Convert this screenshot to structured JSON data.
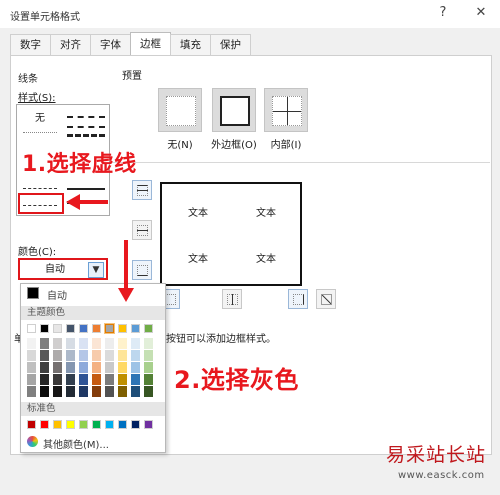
{
  "window": {
    "title": "设置单元格格式",
    "help_icon": "?",
    "close_icon": "✕"
  },
  "tabs": [
    {
      "label": "数字",
      "active": false
    },
    {
      "label": "对齐",
      "active": false
    },
    {
      "label": "字体",
      "active": false
    },
    {
      "label": "边框",
      "active": true
    },
    {
      "label": "填充",
      "active": false
    },
    {
      "label": "保护",
      "active": false
    }
  ],
  "line": {
    "group_label": "线条",
    "style_label": "样式(S):",
    "none_label": "无",
    "color_label": "颜色(C):",
    "color_value": "自动"
  },
  "presets": {
    "group_label": "预置",
    "items": [
      {
        "label": "无(N)"
      },
      {
        "label": "外边框(O)"
      },
      {
        "label": "内部(I)"
      }
    ]
  },
  "border": {
    "preview_cell_text": [
      "文本",
      "文本",
      "文本",
      "文本"
    ],
    "hint_fragment": "按钮可以添加边框样式。",
    "hint_prefix": "单"
  },
  "palette": {
    "auto_label": "自动",
    "theme_label": "主题颜色",
    "standard_label": "标准色",
    "more_label": "其他颜色(M)...",
    "theme_top_row": [
      "#ffffff",
      "#000000",
      "#e7e6e6",
      "#44546a",
      "#4472c4",
      "#ed7d31",
      "#a5a5a5",
      "#ffc000",
      "#5b9bd5",
      "#70ad47"
    ],
    "theme_shades": [
      [
        "#f2f2f2",
        "#7f7f7f",
        "#d0cece",
        "#d6dce4",
        "#d9e2f3",
        "#fbe5d5",
        "#ededed",
        "#fff2cc",
        "#deebf6",
        "#e2efd9"
      ],
      [
        "#d8d8d8",
        "#595959",
        "#aeabab",
        "#adb9ca",
        "#b4c6e7",
        "#f7cbac",
        "#dbdbdb",
        "#fee599",
        "#bdd7ee",
        "#c5e0b3"
      ],
      [
        "#bfbfbf",
        "#3f3f3f",
        "#757070",
        "#8496b0",
        "#8eaadb",
        "#f4b183",
        "#c9c9c9",
        "#ffd965",
        "#9dc3e6",
        "#a8d08d"
      ],
      [
        "#a5a5a5",
        "#262626",
        "#3a3838",
        "#323f4f",
        "#2f5496",
        "#c55a11",
        "#7b7b7b",
        "#bf9000",
        "#2e75b5",
        "#538135"
      ],
      [
        "#7f7f7f",
        "#0c0c0c",
        "#171616",
        "#222a35",
        "#1f3864",
        "#833c0b",
        "#525252",
        "#7f6000",
        "#1e4e79",
        "#375623"
      ]
    ],
    "standard_colors": [
      "#c00000",
      "#ff0000",
      "#ffc000",
      "#ffff00",
      "#92d050",
      "#00b050",
      "#00b0f0",
      "#0070c0",
      "#002060",
      "#7030a0"
    ],
    "selected_color": "#a5a5a5"
  },
  "annotations": {
    "step1": "1.选择虚线",
    "step2": "2.选择灰色",
    "accent_color": "#e8181e"
  },
  "watermark": {
    "cn": "易采站长站",
    "url": "www.easck.com"
  }
}
